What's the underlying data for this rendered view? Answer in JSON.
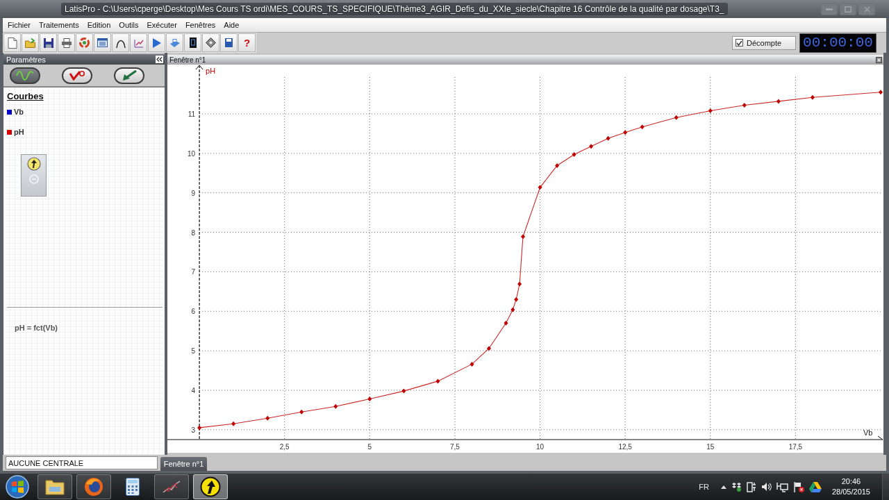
{
  "window": {
    "title": "LatisPro - C:\\Users\\cperge\\Desktop\\Mes Cours TS ordi\\MES_COURS_TS_SPECIFIQUE\\Thème3_AGIR_Defis_du_XXIe_siecle\\Chapitre 16 Contrôle de la qualité par dosage\\T3_"
  },
  "menu": [
    "Fichier",
    "Traitements",
    "Edition",
    "Outils",
    "Exécuter",
    "Fenêtres",
    "Aide"
  ],
  "toolbar": {
    "help": "?",
    "countdown": {
      "label": "Décompte",
      "checked": true
    },
    "timer": "00:00:00"
  },
  "parameters_panel": {
    "title": "Paramètres",
    "view_buttons": [
      {
        "kind": "wave",
        "selected": true
      },
      {
        "kind": "tick",
        "selected": false
      },
      {
        "kind": "arrow",
        "selected": false
      }
    ],
    "section_title": "Courbes",
    "curves": [
      {
        "name": "Vb",
        "color": "#0000cc"
      },
      {
        "name": "pH",
        "color": "#dd0000"
      }
    ],
    "relation": "pH = fct(Vb)"
  },
  "graph_window": {
    "title": "Fenêtre n°1",
    "chart_data": [
      {
        "type": "line",
        "xlabel": "Vb",
        "ylabel": "pH",
        "x": [
          0,
          1,
          2,
          3,
          4,
          5,
          6,
          7,
          8,
          8.5,
          9,
          9.2,
          9.3,
          9.4,
          9.5,
          10,
          10.5,
          11,
          11.5,
          12,
          12.5,
          13,
          14,
          15,
          16,
          17,
          18,
          20
        ],
        "values": [
          3.05,
          3.15,
          3.29,
          3.45,
          3.59,
          3.78,
          3.98,
          4.23,
          4.66,
          5.06,
          5.7,
          6.04,
          6.3,
          6.69,
          7.89,
          9.14,
          9.69,
          9.97,
          10.18,
          10.38,
          10.53,
          10.67,
          10.91,
          11.08,
          11.22,
          11.32,
          11.42,
          11.55
        ],
        "color": "#c00000",
        "marker": "diamond",
        "grid": true,
        "xlim": [
          -0.94,
          20
        ],
        "ylim": [
          2.75,
          12.25
        ],
        "xticks": [
          {
            "value": 2.5,
            "label": "2,5"
          },
          {
            "value": 5,
            "label": "5"
          },
          {
            "value": 7.5,
            "label": "7,5"
          },
          {
            "value": 10,
            "label": "10"
          },
          {
            "value": 12.5,
            "label": "12,5"
          },
          {
            "value": 15,
            "label": "15"
          },
          {
            "value": 17.5,
            "label": "17,5"
          }
        ],
        "yticks": [
          3,
          4,
          5,
          6,
          7,
          8,
          9,
          10,
          11
        ],
        "ref_lines": [
          {
            "axis": "x",
            "value": 0,
            "color": "#111111",
            "line_style": "dashed"
          }
        ]
      }
    ]
  },
  "status_bar": {
    "acquisition": "AUCUNE CENTRALE",
    "tabs": [
      {
        "label": "Fenêtre n°1",
        "selected": true
      }
    ]
  },
  "taskbar": {
    "apps": [
      {
        "kind": "folder",
        "running": true,
        "active": false
      },
      {
        "kind": "browser",
        "running": true,
        "active": false
      },
      {
        "kind": "calculator",
        "running": false,
        "active": false
      },
      {
        "kind": "graph",
        "running": true,
        "active": false
      },
      {
        "kind": "arrow",
        "running": true,
        "active": true
      }
    ],
    "language": "FR",
    "time": "20:46",
    "date": "28/05/2015"
  }
}
